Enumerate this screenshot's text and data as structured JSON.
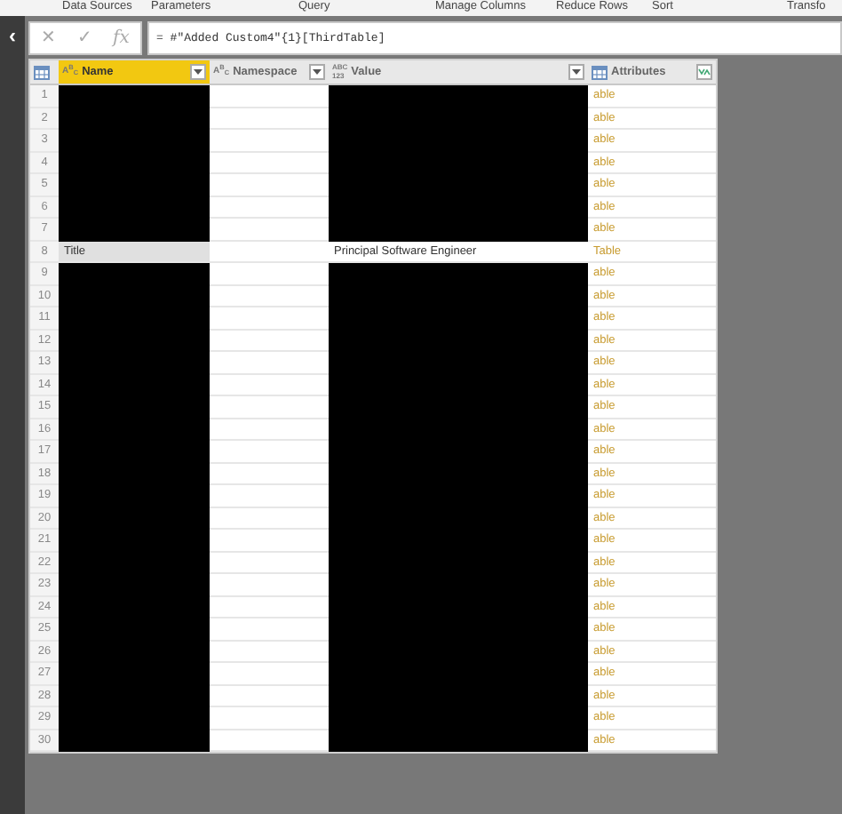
{
  "ribbon": [
    "Data Sources",
    "Parameters",
    "Query",
    "Manage Columns",
    "Reduce Rows",
    "Sort",
    "Transfo"
  ],
  "formula_bar": {
    "cancel": "✕",
    "commit": "✓",
    "fx": "fx",
    "formula": "= #\"Added Custom4\"{1}[ThirdTable]"
  },
  "collapse_button": "‹",
  "columns": [
    {
      "title": "Name",
      "kind": "text",
      "type_label": "A$^{B}$$_{C}$",
      "selected": true
    },
    {
      "title": "Namespace",
      "kind": "text",
      "type_label": "A$^{B}$$_{C}$",
      "selected": false
    },
    {
      "title": "Value",
      "kind": "any",
      "type_label": "ABC",
      "type_label_2": "123",
      "selected": false
    },
    {
      "title": "Attributes",
      "kind": "table",
      "selected": false
    }
  ],
  "rows": [
    {
      "index": "1",
      "name_redacted": true,
      "value_redacted": true,
      "attributes": "able",
      "selected": false
    },
    {
      "index": "2",
      "name_redacted": true,
      "value_redacted": true,
      "attributes": "able",
      "selected": false
    },
    {
      "index": "3",
      "name_redacted": true,
      "value_redacted": true,
      "attributes": "able",
      "selected": false
    },
    {
      "index": "4",
      "name_redacted": true,
      "value_redacted": true,
      "attributes": "able",
      "selected": false
    },
    {
      "index": "5",
      "name_redacted": true,
      "value_redacted": true,
      "attributes": "able",
      "selected": false
    },
    {
      "index": "6",
      "name_redacted": true,
      "value_redacted": true,
      "attributes": "able",
      "selected": false
    },
    {
      "index": "7",
      "name_redacted": true,
      "value_redacted": true,
      "attributes": "able",
      "selected": false
    },
    {
      "index": "8",
      "name": "Title",
      "value": "Principal Software Engineer",
      "attributes": "Table",
      "selected": true
    },
    {
      "index": "9",
      "name_redacted": true,
      "value_redacted": true,
      "attributes": "able",
      "selected": false
    },
    {
      "index": "10",
      "name_redacted": true,
      "value_redacted": true,
      "attributes": "able",
      "selected": false
    },
    {
      "index": "11",
      "name_redacted": true,
      "value_redacted": true,
      "attributes": "able",
      "selected": false
    },
    {
      "index": "12",
      "name_redacted": true,
      "value_redacted": true,
      "attributes": "able",
      "selected": false
    },
    {
      "index": "13",
      "name_redacted": true,
      "value_redacted": true,
      "attributes": "able",
      "selected": false
    },
    {
      "index": "14",
      "name_redacted": true,
      "value_redacted": true,
      "attributes": "able",
      "selected": false
    },
    {
      "index": "15",
      "name_redacted": true,
      "value_redacted": true,
      "attributes": "able",
      "selected": false
    },
    {
      "index": "16",
      "name_redacted": true,
      "value_redacted": true,
      "attributes": "able",
      "selected": false
    },
    {
      "index": "17",
      "name_redacted": true,
      "value_redacted": true,
      "attributes": "able",
      "selected": false
    },
    {
      "index": "18",
      "name_redacted": true,
      "value_redacted": true,
      "attributes": "able",
      "selected": false
    },
    {
      "index": "19",
      "name_redacted": true,
      "value_redacted": true,
      "attributes": "able",
      "selected": false
    },
    {
      "index": "20",
      "name_redacted": true,
      "value_redacted": true,
      "attributes": "able",
      "selected": false
    },
    {
      "index": "21",
      "name_redacted": true,
      "value_redacted": true,
      "attributes": "able",
      "selected": false
    },
    {
      "index": "22",
      "name_redacted": true,
      "value_redacted": true,
      "attributes": "able",
      "selected": false
    },
    {
      "index": "23",
      "name_redacted": true,
      "value_redacted": true,
      "attributes": "able",
      "selected": false
    },
    {
      "index": "24",
      "name_redacted": true,
      "value_redacted": true,
      "attributes": "able",
      "selected": false
    },
    {
      "index": "25",
      "name_redacted": true,
      "value_redacted": true,
      "attributes": "able",
      "selected": false
    },
    {
      "index": "26",
      "name_redacted": true,
      "value_redacted": true,
      "attributes": "able",
      "selected": false
    },
    {
      "index": "27",
      "name_redacted": true,
      "value_redacted": true,
      "attributes": "able",
      "selected": false
    },
    {
      "index": "28",
      "name_redacted": true,
      "value_redacted": true,
      "attributes": "able",
      "selected": false
    },
    {
      "index": "29",
      "name_redacted": true,
      "value_redacted": true,
      "attributes": "able",
      "selected": false
    },
    {
      "index": "30",
      "name_redacted": true,
      "value_redacted": true,
      "attributes": "able",
      "selected": false
    }
  ]
}
